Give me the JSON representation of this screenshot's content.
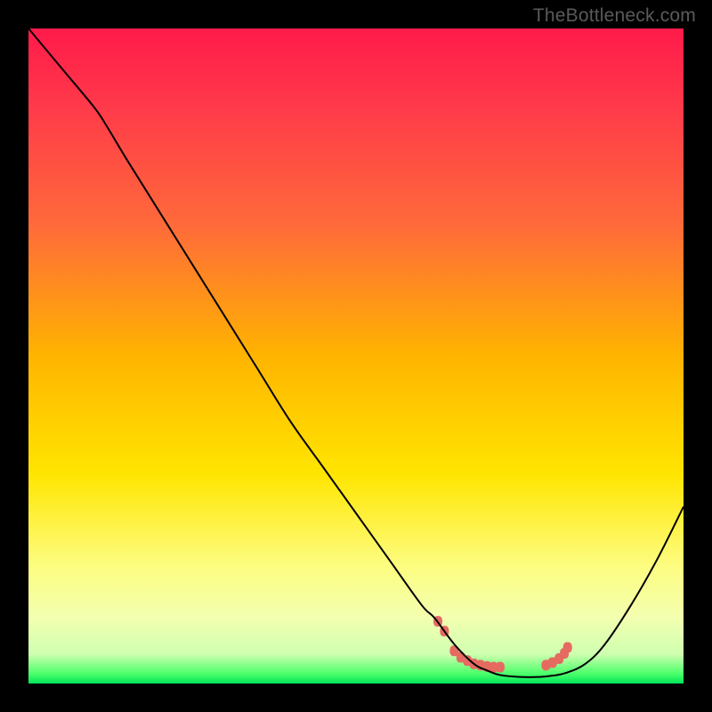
{
  "watermark": "TheBottleneck.com",
  "chart_data": {
    "type": "line",
    "title": "",
    "xlabel": "",
    "ylabel": "",
    "xlim": [
      0,
      100
    ],
    "ylim": [
      0,
      100
    ],
    "grid": false,
    "background_gradient": {
      "stops": [
        {
          "offset": 0.0,
          "color": "#ff1a4a"
        },
        {
          "offset": 0.12,
          "color": "#ff3a4a"
        },
        {
          "offset": 0.3,
          "color": "#ff6a3a"
        },
        {
          "offset": 0.5,
          "color": "#ffb400"
        },
        {
          "offset": 0.68,
          "color": "#ffe500"
        },
        {
          "offset": 0.82,
          "color": "#fdfd80"
        },
        {
          "offset": 0.9,
          "color": "#f3ffb0"
        },
        {
          "offset": 0.955,
          "color": "#cfffb0"
        },
        {
          "offset": 0.985,
          "color": "#4cff6a"
        },
        {
          "offset": 1.0,
          "color": "#00e55a"
        }
      ]
    },
    "series": [
      {
        "name": "bottleneck-curve",
        "color": "#000000",
        "stroke_width": 2,
        "x": [
          0,
          5,
          10,
          12,
          15,
          20,
          25,
          30,
          35,
          40,
          45,
          50,
          55,
          60,
          62,
          65,
          68,
          70,
          72,
          75,
          78,
          80,
          82,
          85,
          88,
          92,
          96,
          100
        ],
        "y": [
          100,
          94,
          88,
          85,
          80,
          72,
          64,
          56,
          48,
          40,
          33,
          26,
          19,
          12,
          10,
          6,
          3,
          2,
          1.3,
          1,
          1,
          1.2,
          1.6,
          3,
          6,
          12,
          19,
          27
        ]
      }
    ],
    "markers": {
      "name": "bottom-cluster",
      "color": "#e56a60",
      "shape": "round-rect",
      "points": [
        {
          "x": 62.5,
          "y": 9.5
        },
        {
          "x": 63.5,
          "y": 8.0
        },
        {
          "x": 65.0,
          "y": 5.0
        },
        {
          "x": 66.0,
          "y": 4.0
        },
        {
          "x": 67.0,
          "y": 3.5
        },
        {
          "x": 68.0,
          "y": 3.0
        },
        {
          "x": 69.0,
          "y": 2.8
        },
        {
          "x": 70.0,
          "y": 2.6
        },
        {
          "x": 71.0,
          "y": 2.5
        },
        {
          "x": 72.0,
          "y": 2.5
        },
        {
          "x": 79.0,
          "y": 2.8
        },
        {
          "x": 80.0,
          "y": 3.2
        },
        {
          "x": 81.0,
          "y": 3.8
        },
        {
          "x": 81.8,
          "y": 4.6
        },
        {
          "x": 82.3,
          "y": 5.5
        }
      ]
    }
  }
}
